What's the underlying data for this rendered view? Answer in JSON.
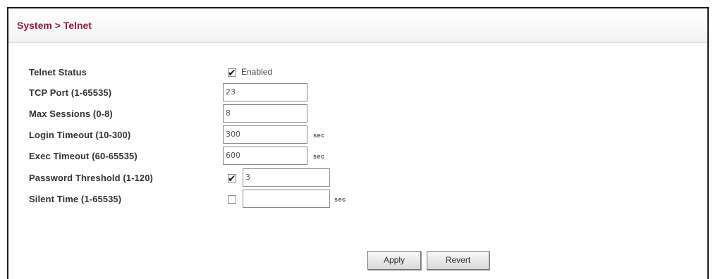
{
  "breadcrumb": "System > Telnet",
  "fields": {
    "telnet_status": {
      "label": "Telnet Status",
      "checked": true,
      "checkbox_label": "Enabled"
    },
    "tcp_port": {
      "label": "TCP Port (1-65535)",
      "value": "23"
    },
    "max_sessions": {
      "label": "Max Sessions (0-8)",
      "value": "8"
    },
    "login_timeout": {
      "label": "Login Timeout (10-300)",
      "value": "300",
      "unit": "sec"
    },
    "exec_timeout": {
      "label": "Exec Timeout (60-65535)",
      "value": "600",
      "unit": "sec"
    },
    "password_threshold": {
      "label": "Password Threshold (1-120)",
      "checked": true,
      "value": "3"
    },
    "silent_time": {
      "label": "Silent Time (1-65535)",
      "checked": false,
      "value": "",
      "unit": "sec"
    }
  },
  "buttons": {
    "apply": "Apply",
    "revert": "Revert"
  }
}
